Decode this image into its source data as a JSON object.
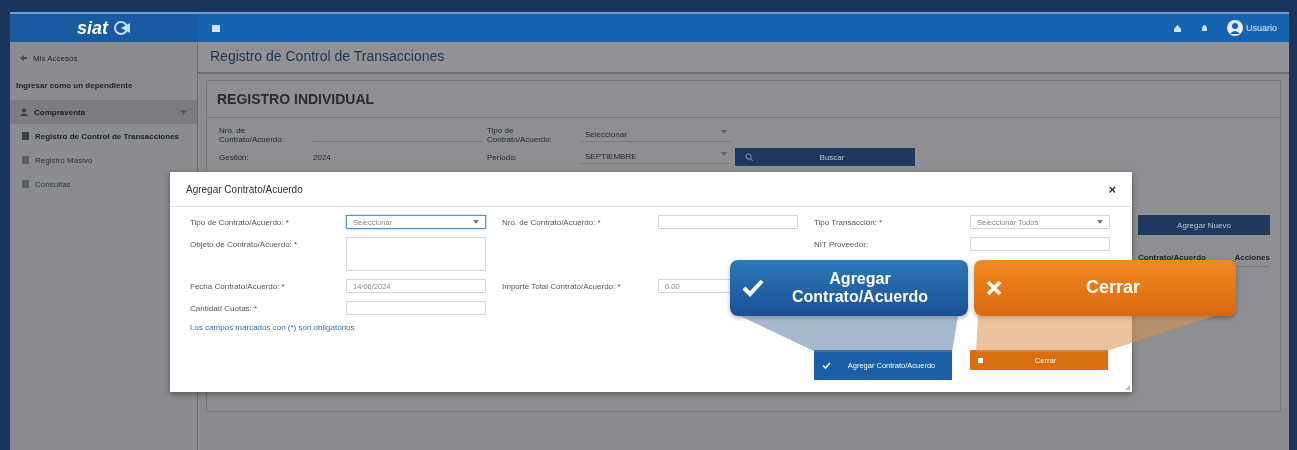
{
  "header": {
    "logo": "siat",
    "user": "Usuario"
  },
  "sidebar": {
    "items": [
      {
        "label": "Mis Accesos",
        "kind": "link"
      },
      {
        "label": "Ingresar como un dependiente",
        "kind": "heading"
      },
      {
        "label": "Compraventa",
        "kind": "group",
        "expanded": true,
        "children": [
          {
            "label": "Registro de Control de Transacciones",
            "selected": true
          },
          {
            "label": "Registro Masivo",
            "selected": false
          },
          {
            "label": "Consultas",
            "selected": false
          }
        ]
      }
    ]
  },
  "main": {
    "title": "Registro de Control de Transacciones",
    "section": "REGISTRO INDIVIDUAL",
    "filters": [
      {
        "label": "Nro. de Contrato/Acuerdo:",
        "kind": "input"
      },
      {
        "label": "Tipo de Contrato/Acuerdo:",
        "kind": "select",
        "value": "Seleccionar"
      },
      {
        "label": "Gestión:",
        "kind": "text",
        "value": "2024"
      },
      {
        "label": "Periodo:",
        "kind": "select",
        "value": "SEPTIEMBRE"
      }
    ],
    "search_button": "Buscar",
    "add_button": "Agregar Nuevo",
    "table": {
      "columns": [
        "Contrato/Acuerdo",
        "Acciones"
      ]
    }
  },
  "modal": {
    "title": "Agregar Contrato/Acuerdo",
    "close": "×",
    "rows": [
      {
        "left": {
          "label": "Tipo de Contrato/Acuerdo: *",
          "kind": "select",
          "value": "Seleccionar",
          "focused": true
        },
        "middle": {
          "label": "Nro. de Contrato/Acuerdo: *",
          "kind": "input"
        },
        "right": {
          "label": "Tipo Transacción: *",
          "kind": "select",
          "value": "Seleccionar Todos",
          "focused": false
        }
      },
      {
        "left": {
          "label": "Objeto de Contrato/Acuerdo: *",
          "kind": "textarea"
        },
        "right": {
          "label": "NIT Proveedor:",
          "kind": "input"
        }
      },
      {
        "left": {
          "label": "Fecha Contrato/Acuerdo: *",
          "kind": "input",
          "value": "14/06/2024"
        },
        "middle": {
          "label": "Importe Total Contrato/Acuerdo: *",
          "kind": "input",
          "value": "0.00"
        }
      },
      {
        "left": {
          "label": "Cantidad Cuotas: *",
          "kind": "input"
        }
      }
    ],
    "note": "Los campos marcados con (*) son obligatorios",
    "buttons": [
      {
        "kind": "add",
        "label": "Agregar Contrato/Acuerdo"
      },
      {
        "kind": "close",
        "label": "Cerrar"
      }
    ]
  },
  "annotations": [
    {
      "kind": "add",
      "text": "Agregar Contrato/Acuerdo"
    },
    {
      "kind": "close",
      "text": "Cerrar"
    }
  ]
}
